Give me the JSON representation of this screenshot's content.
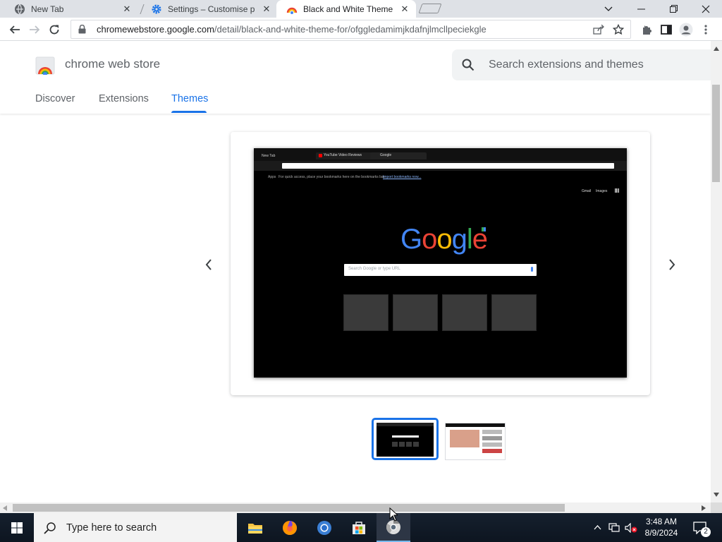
{
  "tabs": [
    {
      "title": "New Tab",
      "favicon": "globe-icon"
    },
    {
      "title": "Settings – Customise p",
      "favicon": "gear-icon"
    },
    {
      "title": "Black and White Theme",
      "favicon": "chrome-web-store-icon",
      "active": true
    }
  ],
  "window_controls": [
    "chevron-down-icon",
    "minimize-icon",
    "restore-icon",
    "close-icon"
  ],
  "toolbar": {
    "url_host": "chromewebstore.google.com",
    "url_path": "/detail/black-and-white-theme-for/ofggledamimjkdafnjlmcllpeciekgle"
  },
  "store": {
    "name": "chrome web store",
    "search_placeholder": "Search extensions and themes",
    "nav": [
      {
        "label": "Discover"
      },
      {
        "label": "Extensions"
      },
      {
        "label": "Themes",
        "active": true
      }
    ]
  },
  "preview": {
    "tab1": "New Tab",
    "tab2": "YouTube Video Reviews",
    "tab3": "Google",
    "bookmarks_text": "For quick access, place your bookmarks here on the bookmarks bar.",
    "bookmarks_link": "Import bookmarks now...",
    "apps_label": "Apps",
    "links": [
      "Gmail",
      "Images"
    ],
    "search_placeholder": "Search Google or type URL",
    "logo": [
      "G",
      "o",
      "o",
      "g",
      "l",
      "e"
    ],
    "logo_colors": [
      "#4285f4",
      "#ea4335",
      "#fbbc05",
      "#4285f4",
      "#34a853",
      "#ea4335"
    ]
  },
  "taskbar": {
    "search_placeholder": "Type here to search",
    "time": "3:48 AM",
    "date": "8/9/2024",
    "notifications": "2"
  },
  "colors": {
    "accent": "#1a73e8",
    "tabstrip": "#dee1e6",
    "taskbar": "#101826"
  }
}
